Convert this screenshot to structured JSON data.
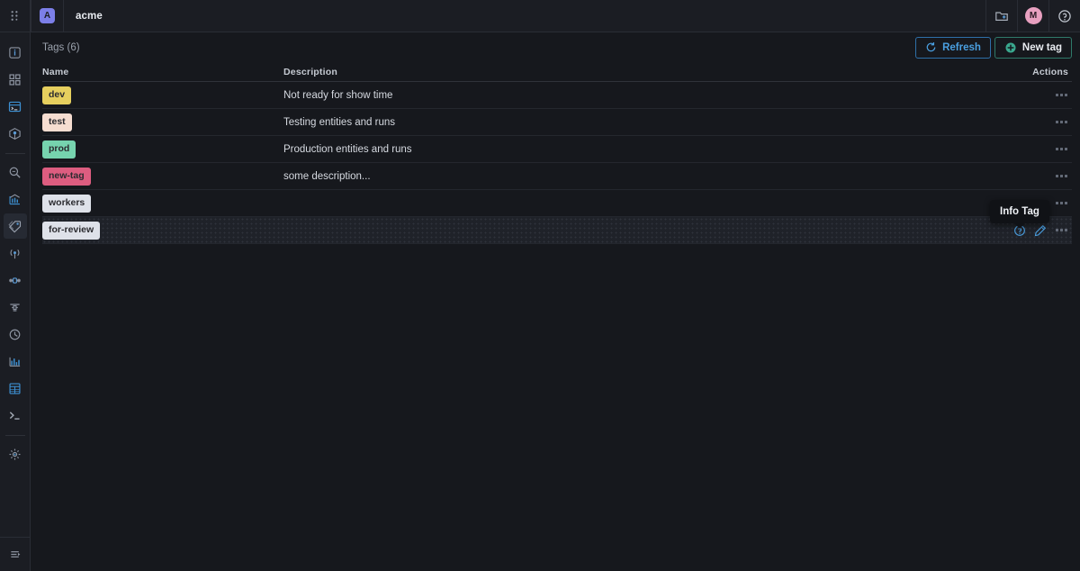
{
  "topbar": {
    "apps_menu_icon": "dots-grid-icon",
    "org_initial": "A",
    "org_name": "acme",
    "new_folder_icon": "new-folder-icon",
    "user_initial": "M",
    "help_icon": "help-circle-icon"
  },
  "sidebar": {
    "menu_icon": "dots-grid-icon",
    "collapse_icon": "collapse-sidebar-icon",
    "items": [
      {
        "name": "overview",
        "icon": "info-square-icon",
        "active": false
      },
      {
        "name": "dashboards",
        "icon": "grid-squares-icon",
        "active": false
      },
      {
        "name": "console",
        "icon": "console-window-icon",
        "active": false
      },
      {
        "name": "artifacts",
        "icon": "package-box-icon",
        "active": false
      },
      {
        "divider": true
      },
      {
        "name": "search",
        "icon": "search-icon",
        "active": false
      },
      {
        "name": "analytics",
        "icon": "chart-bank-icon",
        "active": false
      },
      {
        "name": "tags",
        "icon": "tags-icon",
        "active": true
      },
      {
        "name": "streaming",
        "icon": "broadcast-icon",
        "active": false
      },
      {
        "name": "pipelines",
        "icon": "pipeline-icon",
        "active": false
      },
      {
        "name": "filters",
        "icon": "sliders-icon",
        "active": false
      },
      {
        "name": "history",
        "icon": "clock-history-icon",
        "active": false
      },
      {
        "name": "metrics",
        "icon": "bar-chart-icon",
        "active": false
      },
      {
        "name": "tables",
        "icon": "table-grid-icon",
        "active": false
      },
      {
        "name": "terminal",
        "icon": "terminal-prompt-icon",
        "active": false
      },
      {
        "divider": true
      },
      {
        "name": "settings",
        "icon": "gear-icon",
        "active": false
      }
    ]
  },
  "page": {
    "title": "Tags (6)",
    "refresh_label": "Refresh",
    "refresh_icon": "refresh-icon",
    "new_tag_label": "New tag",
    "new_tag_icon": "plus-circle-icon"
  },
  "table": {
    "headers": {
      "name": "Name",
      "description": "Description",
      "actions": "Actions"
    },
    "rows": [
      {
        "tag": "dev",
        "tag_color": "#e6cf5e",
        "description": "Not ready for show time",
        "hover": false,
        "show_row_icons": false
      },
      {
        "tag": "test",
        "tag_color": "#f6ddd1",
        "description": "Testing entities and runs",
        "hover": false,
        "show_row_icons": false
      },
      {
        "tag": "prod",
        "tag_color": "#76d3ae",
        "description": "Production entities and runs",
        "hover": false,
        "show_row_icons": false
      },
      {
        "tag": "new-tag",
        "tag_color": "#dd5d80",
        "description": "some description...",
        "hover": false,
        "show_row_icons": false
      },
      {
        "tag": "workers",
        "tag_color": "#dee1e9",
        "description": "",
        "hover": false,
        "show_row_icons": false
      },
      {
        "tag": "for-review",
        "tag_color": "#dee1e9",
        "description": "",
        "hover": true,
        "show_row_icons": true
      }
    ],
    "row_action_icons": {
      "info": "info-circle-icon",
      "edit": "pencil-edit-icon",
      "more": "more-options-icon"
    }
  },
  "tooltip": {
    "text": "Info Tag",
    "visible": true
  },
  "colors": {
    "background": "#16181d",
    "panel": "#1b1d23",
    "border": "#2a2d35",
    "accent_blue": "#4a9fe0",
    "accent_teal": "#2f7a6a",
    "avatar_pink": "#e8a0c0",
    "org_purple": "#7c7fe8"
  }
}
